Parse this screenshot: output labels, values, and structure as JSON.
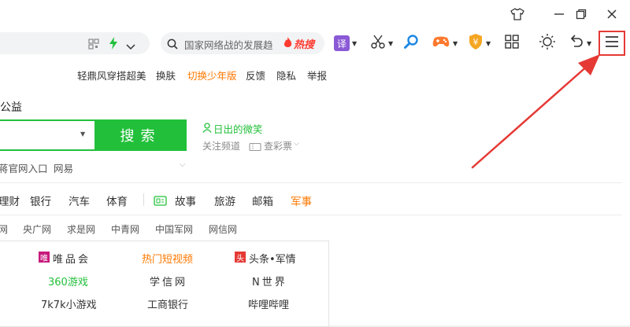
{
  "search_box": {
    "placeholder": "国家网络战的发展趋",
    "hot_label": "热搜"
  },
  "top_links": [
    "轻鼎风穿搭超美",
    "换肤",
    "切换少年版",
    "反馈",
    "隐私",
    "举报"
  ],
  "section_label": "公益",
  "main_search": {
    "button_label": "搜索"
  },
  "weibo": {
    "link": "日出的微笑",
    "follow": "关注频道",
    "ticket": "查彩票"
  },
  "quick_links": [
    "蒋官网入口",
    "网易"
  ],
  "nav": [
    "理财",
    "银行",
    "汽车",
    "体育",
    "故事",
    "旅游",
    "邮箱",
    "军事"
  ],
  "sites": [
    "网",
    "央广网",
    "求是网",
    "中青网",
    "中国军网",
    "网信网"
  ],
  "hot_grid": {
    "row1": [
      "唯品会",
      "热门短视频",
      "头条•军情"
    ],
    "row2": [
      "360游戏",
      "学信网",
      "N世界"
    ],
    "row3": [
      "7k7k小游戏",
      "工商银行",
      "哔哩哔哩"
    ]
  },
  "colors": {
    "accent_green": "#22c03a",
    "highlight_orange": "#ff7800",
    "callout_red": "#e53935"
  },
  "icons": {
    "qr": "qr-code-icon",
    "bolt": "lightning-icon",
    "chevron": "chevron-down-icon",
    "search": "search-icon",
    "fire": "fire-icon",
    "translate": "translate-icon",
    "scissors": "scissors-icon",
    "magnifier": "magnifier-icon",
    "game": "gamepad-icon",
    "coupon": "coupon-shield-icon",
    "apps": "apps-grid-icon",
    "brightness": "brightness-icon",
    "undo": "undo-icon",
    "menu": "hamburger-menu-icon"
  }
}
